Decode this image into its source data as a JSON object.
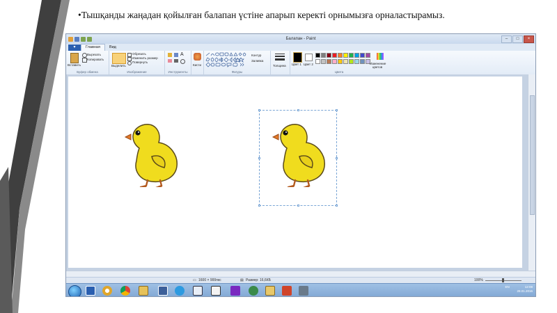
{
  "slide": {
    "caption": "•Тышқанды жаңадан қойылған балапан үстіне апарып керекті орнымызға орналастырамыз."
  },
  "window": {
    "title": "Балапан - Paint"
  },
  "menu": {
    "file_label": "",
    "tabs": [
      {
        "label": "Главная",
        "active": true
      },
      {
        "label": "Вид",
        "active": false
      }
    ]
  },
  "ribbon": {
    "clipboard": {
      "paste": "Вставить",
      "cut": "Вырезать",
      "copy": "Копировать",
      "group": "Буфер обмена"
    },
    "image": {
      "select": "Выделить",
      "crop": "Обрезать",
      "resize": "Изменить размер",
      "rotate": "Повернуть",
      "group": "Изображение"
    },
    "tools": {
      "group": "Инструменты"
    },
    "brushes": {
      "label": "Кисти"
    },
    "shapes": {
      "outline": "Контур",
      "fill": "Заливка",
      "group": "Фигуры"
    },
    "thickness": {
      "label": "Толщина"
    },
    "colors": {
      "color1": "Цвет 1",
      "color2": "Цвет 2",
      "edit": "Изменение цветов",
      "group": "Цвета",
      "swatches": [
        "#000000",
        "#7f7f7f",
        "#880015",
        "#ed1c24",
        "#ff7f27",
        "#fff200",
        "#22b14c",
        "#00a2e8",
        "#3f48cc",
        "#a349a4",
        "#ffffff",
        "#c3c3c3",
        "#b97a57",
        "#ffaec9",
        "#ffc90e",
        "#efe4b0",
        "#b5e61d",
        "#99d9ea",
        "#7092be",
        "#c8bfe7"
      ]
    }
  },
  "status": {
    "dimensions": "1600 × 900пкс",
    "size": "Размер: 16,6КБ",
    "zoom": "100%"
  },
  "taskbar": {
    "lang": "EN",
    "time": "12:08",
    "date": "28.01.2016"
  }
}
